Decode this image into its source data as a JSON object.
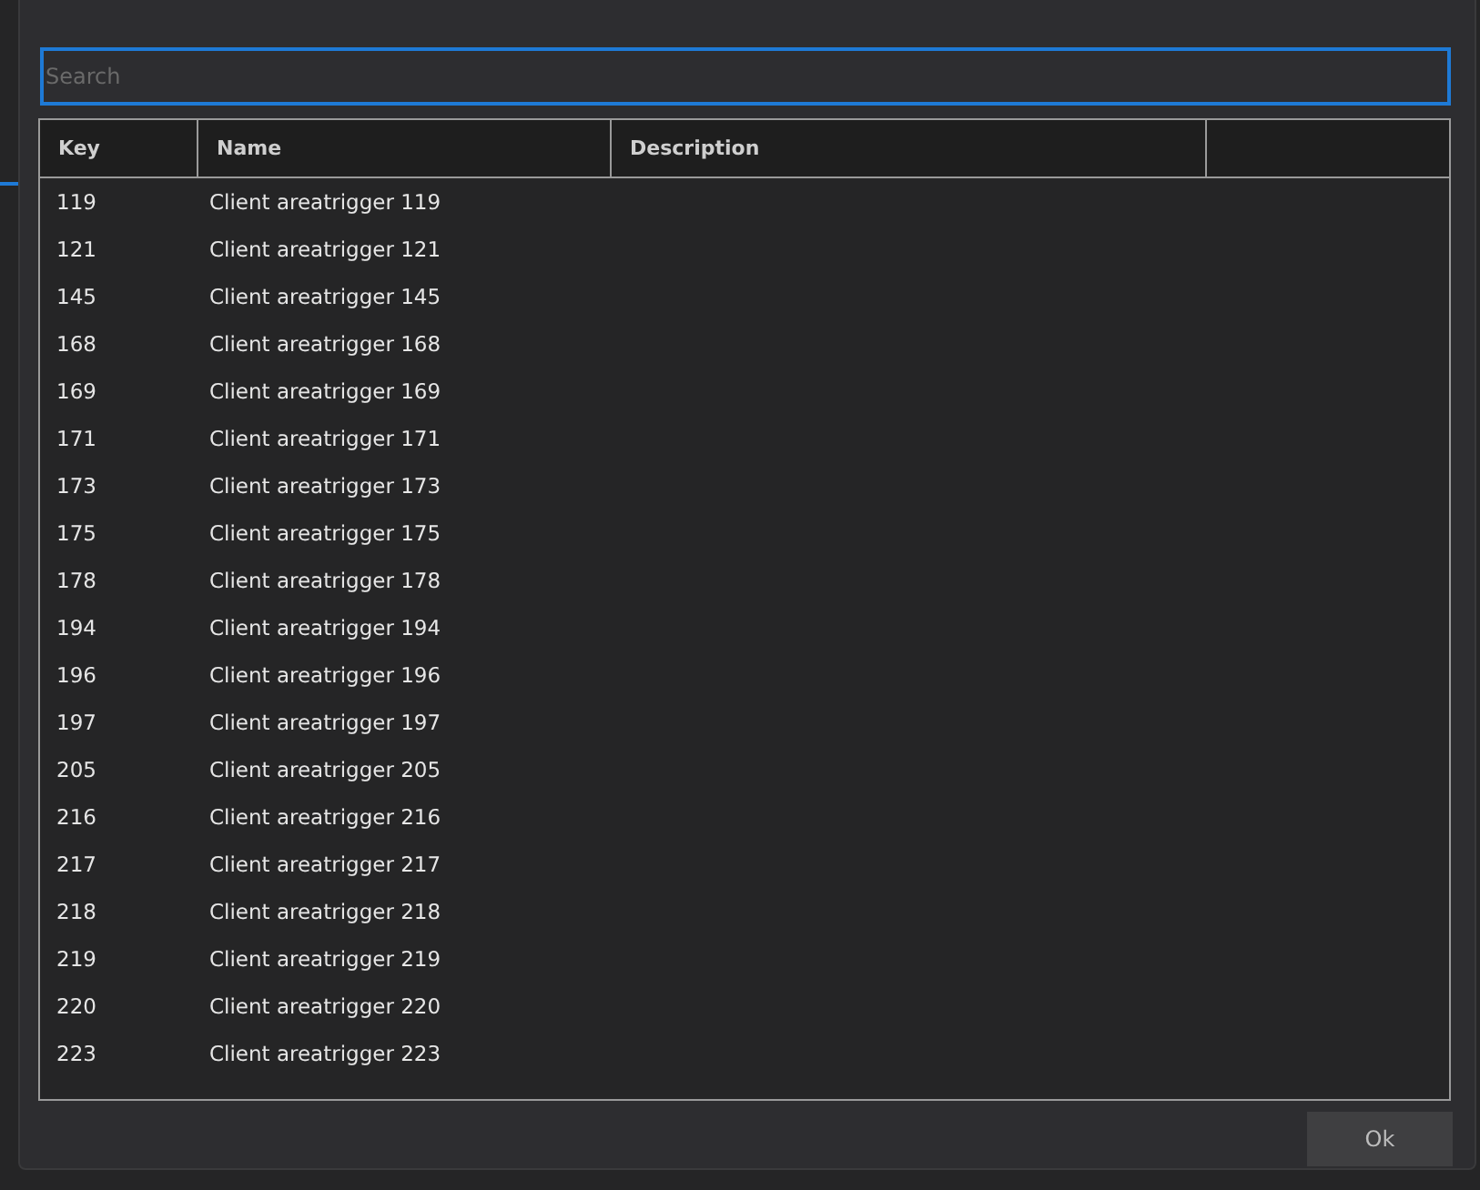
{
  "search": {
    "placeholder": "Search"
  },
  "table": {
    "columns": [
      "Key",
      "Name",
      "Description"
    ],
    "rows": [
      {
        "key": "119",
        "name": "Client areatrigger 119"
      },
      {
        "key": "121",
        "name": "Client areatrigger 121"
      },
      {
        "key": "145",
        "name": "Client areatrigger 145"
      },
      {
        "key": "168",
        "name": "Client areatrigger 168"
      },
      {
        "key": "169",
        "name": "Client areatrigger 169"
      },
      {
        "key": "171",
        "name": "Client areatrigger 171"
      },
      {
        "key": "173",
        "name": "Client areatrigger 173"
      },
      {
        "key": "175",
        "name": "Client areatrigger 175"
      },
      {
        "key": "178",
        "name": "Client areatrigger 178"
      },
      {
        "key": "194",
        "name": "Client areatrigger 194"
      },
      {
        "key": "196",
        "name": "Client areatrigger 196"
      },
      {
        "key": "197",
        "name": "Client areatrigger 197"
      },
      {
        "key": "205",
        "name": "Client areatrigger 205"
      },
      {
        "key": "216",
        "name": "Client areatrigger 216"
      },
      {
        "key": "217",
        "name": "Client areatrigger 217"
      },
      {
        "key": "218",
        "name": "Client areatrigger 218"
      },
      {
        "key": "219",
        "name": "Client areatrigger 219"
      },
      {
        "key": "220",
        "name": "Client areatrigger 220"
      },
      {
        "key": "223",
        "name": "Client areatrigger 223"
      }
    ]
  },
  "buttons": [
    "Ok"
  ]
}
